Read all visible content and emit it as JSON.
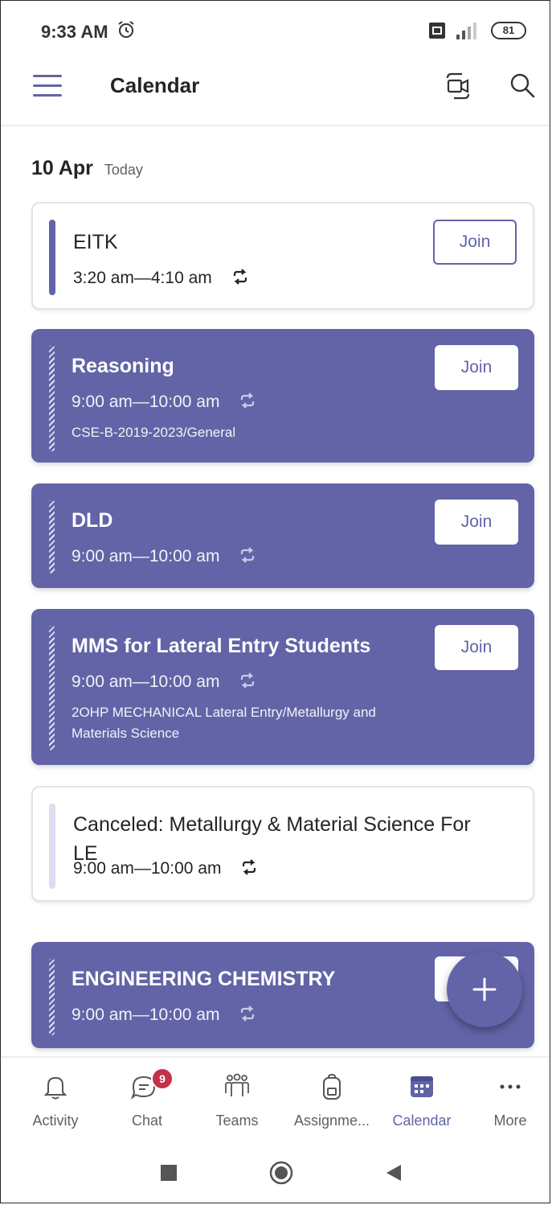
{
  "status_bar": {
    "time": "9:33 AM",
    "battery": "81",
    "icons": [
      "alarm-icon",
      "sim-card-icon",
      "signal-icon",
      "battery-icon"
    ]
  },
  "header": {
    "title": "Calendar",
    "icons": [
      "hamburger-menu-icon",
      "meet-now-icon",
      "search-icon"
    ]
  },
  "date_header": {
    "date": "10 Apr",
    "label": "Today"
  },
  "events": [
    {
      "title": "EITK",
      "time": "3:20 am—4:10 am",
      "channel": "",
      "join_label": "Join",
      "style": "light"
    },
    {
      "title": "Reasoning",
      "time": "9:00 am—10:00 am",
      "channel": "CSE-B-2019-2023/General",
      "join_label": "Join",
      "style": "dark"
    },
    {
      "title": "DLD",
      "time": "9:00 am—10:00 am",
      "channel": "",
      "join_label": "Join",
      "style": "dark"
    },
    {
      "title": "MMS for Lateral Entry Students",
      "time": "9:00 am—10:00 am",
      "channel": "2OHP MECHANICAL Lateral Entry/Metallurgy and Materials Science",
      "join_label": "Join",
      "style": "dark"
    },
    {
      "title": "Canceled: Metallurgy & Material Science For LE",
      "time": "9:00 am—10:00 am",
      "channel": "",
      "join_label": "",
      "style": "canceled"
    },
    {
      "title": "ENGINEERING CHEMISTRY",
      "time": "9:00 am—10:00 am",
      "channel": "",
      "join_label": "",
      "style": "dark"
    }
  ],
  "fab": {
    "icon": "plus-icon"
  },
  "bottom_nav": {
    "items": [
      {
        "label": "Activity",
        "icon": "bell-icon"
      },
      {
        "label": "Chat",
        "icon": "chat-icon",
        "badge": "9"
      },
      {
        "label": "Teams",
        "icon": "teams-icon"
      },
      {
        "label": "Assignme...",
        "icon": "backpack-icon"
      },
      {
        "label": "Calendar",
        "icon": "calendar-icon",
        "active": true
      },
      {
        "label": "More",
        "icon": "more-icon"
      }
    ]
  },
  "system_nav": {
    "icons": [
      "recent-apps-icon",
      "home-icon",
      "back-icon"
    ]
  },
  "colors": {
    "accent": "#6264a7",
    "badge": "#c4314b",
    "text": "#242424",
    "muted": "#616161"
  }
}
